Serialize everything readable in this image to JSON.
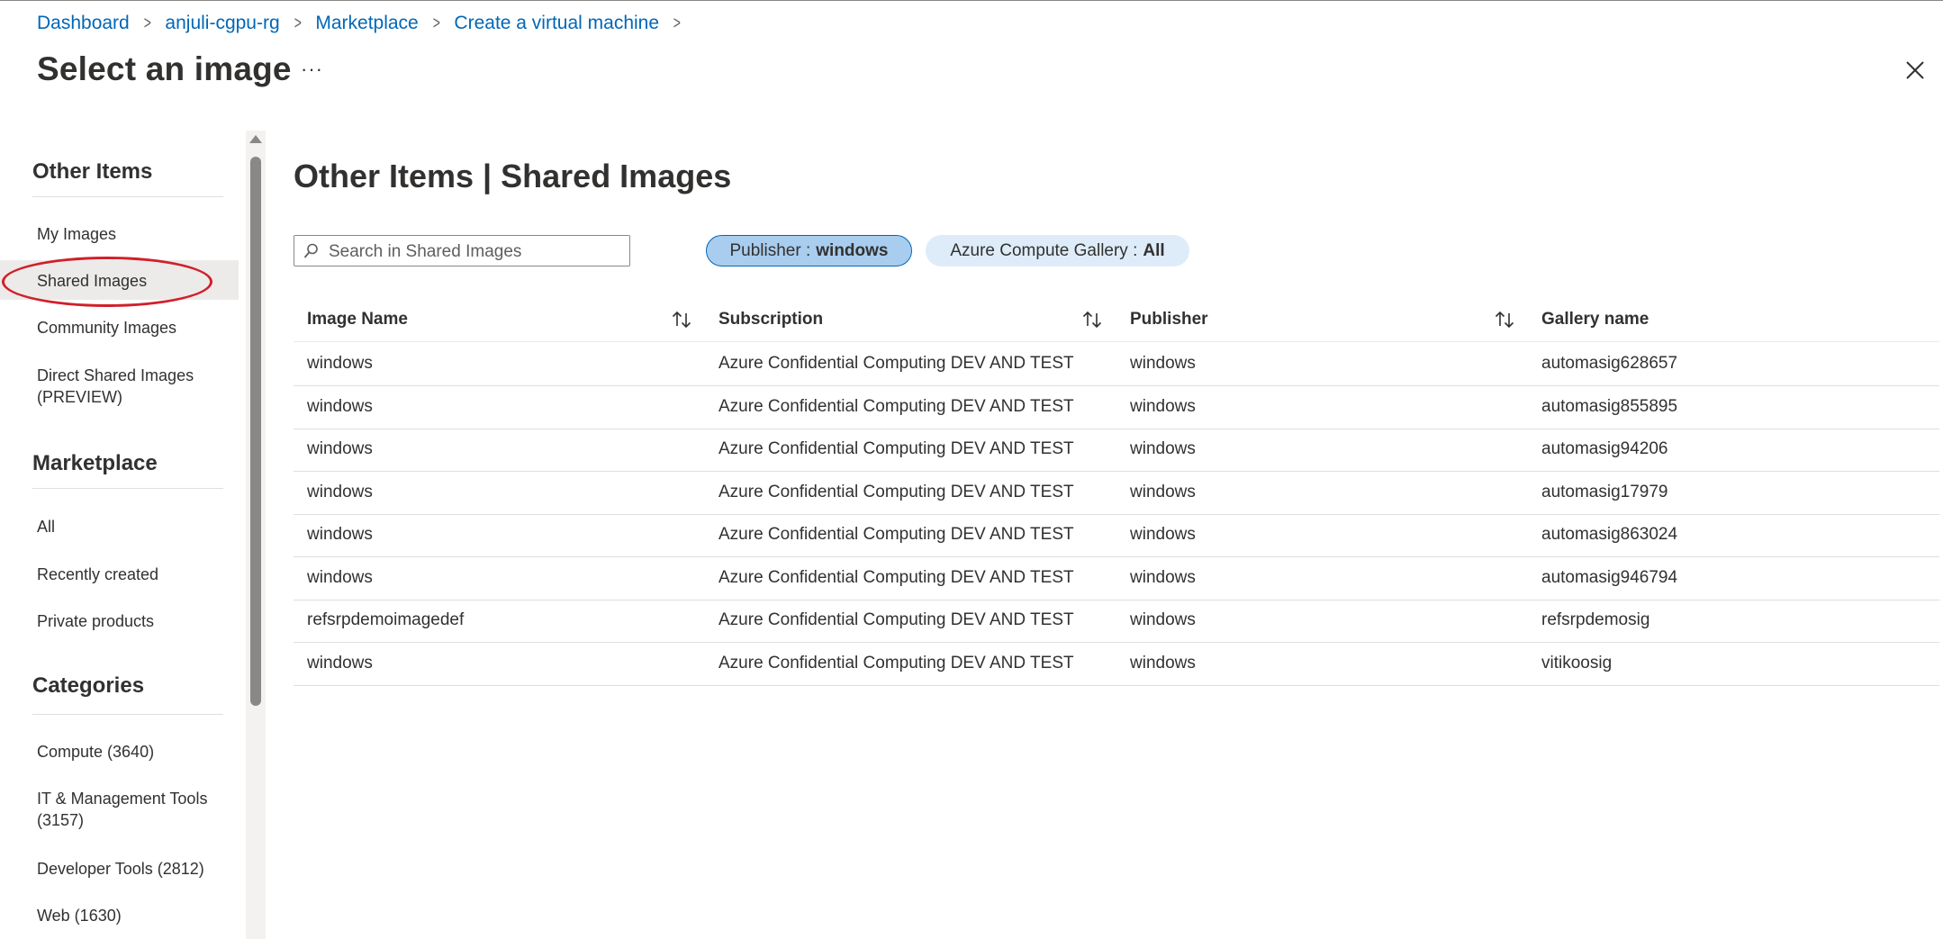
{
  "breadcrumb": [
    {
      "label": "Dashboard"
    },
    {
      "label": "anjuli-cgpu-rg"
    },
    {
      "label": "Marketplace"
    },
    {
      "label": "Create a virtual machine"
    }
  ],
  "page_title": "Select an image",
  "more_label": "···",
  "sidebar": {
    "sections": [
      {
        "heading": "Other Items",
        "items": [
          "My Images",
          "Shared Images",
          "Community Images",
          "Direct Shared Images (PREVIEW)"
        ]
      },
      {
        "heading": "Marketplace",
        "items": [
          "All",
          "Recently created",
          "Private products"
        ]
      },
      {
        "heading": "Categories",
        "items": [
          "Compute (3640)",
          "IT & Management Tools (3157)",
          "Developer Tools (2812)",
          "Web (1630)"
        ]
      }
    ],
    "selected": "Shared Images"
  },
  "main": {
    "title": "Other Items | Shared Images",
    "search": {
      "placeholder": "Search in Shared Images",
      "value": ""
    },
    "filters": [
      {
        "label": "Publisher : ",
        "value": "windows",
        "active": true
      },
      {
        "label": "Azure Compute Gallery : ",
        "value": "All",
        "active": false
      }
    ],
    "table": {
      "columns": [
        "Image Name",
        "Subscription",
        "Publisher",
        "Gallery name"
      ],
      "rows": [
        [
          "windows",
          "Azure Confidential Computing DEV AND TEST",
          "windows",
          "automasig628657"
        ],
        [
          "windows",
          "Azure Confidential Computing DEV AND TEST",
          "windows",
          "automasig855895"
        ],
        [
          "windows",
          "Azure Confidential Computing DEV AND TEST",
          "windows",
          "automasig94206"
        ],
        [
          "windows",
          "Azure Confidential Computing DEV AND TEST",
          "windows",
          "automasig17979"
        ],
        [
          "windows",
          "Azure Confidential Computing DEV AND TEST",
          "windows",
          "automasig863024"
        ],
        [
          "windows",
          "Azure Confidential Computing DEV AND TEST",
          "windows",
          "automasig946794"
        ],
        [
          "refsrpdemoimagedef",
          "Azure Confidential Computing DEV AND TEST",
          "windows",
          "refsrpdemosig"
        ],
        [
          "windows",
          "Azure Confidential Computing DEV AND TEST",
          "windows",
          "vitikoosig"
        ]
      ]
    }
  },
  "colors": {
    "link": "#0067b8",
    "accent_pill": "#a9cdee",
    "pill": "#deecf9",
    "annotation": "#d0202a"
  }
}
